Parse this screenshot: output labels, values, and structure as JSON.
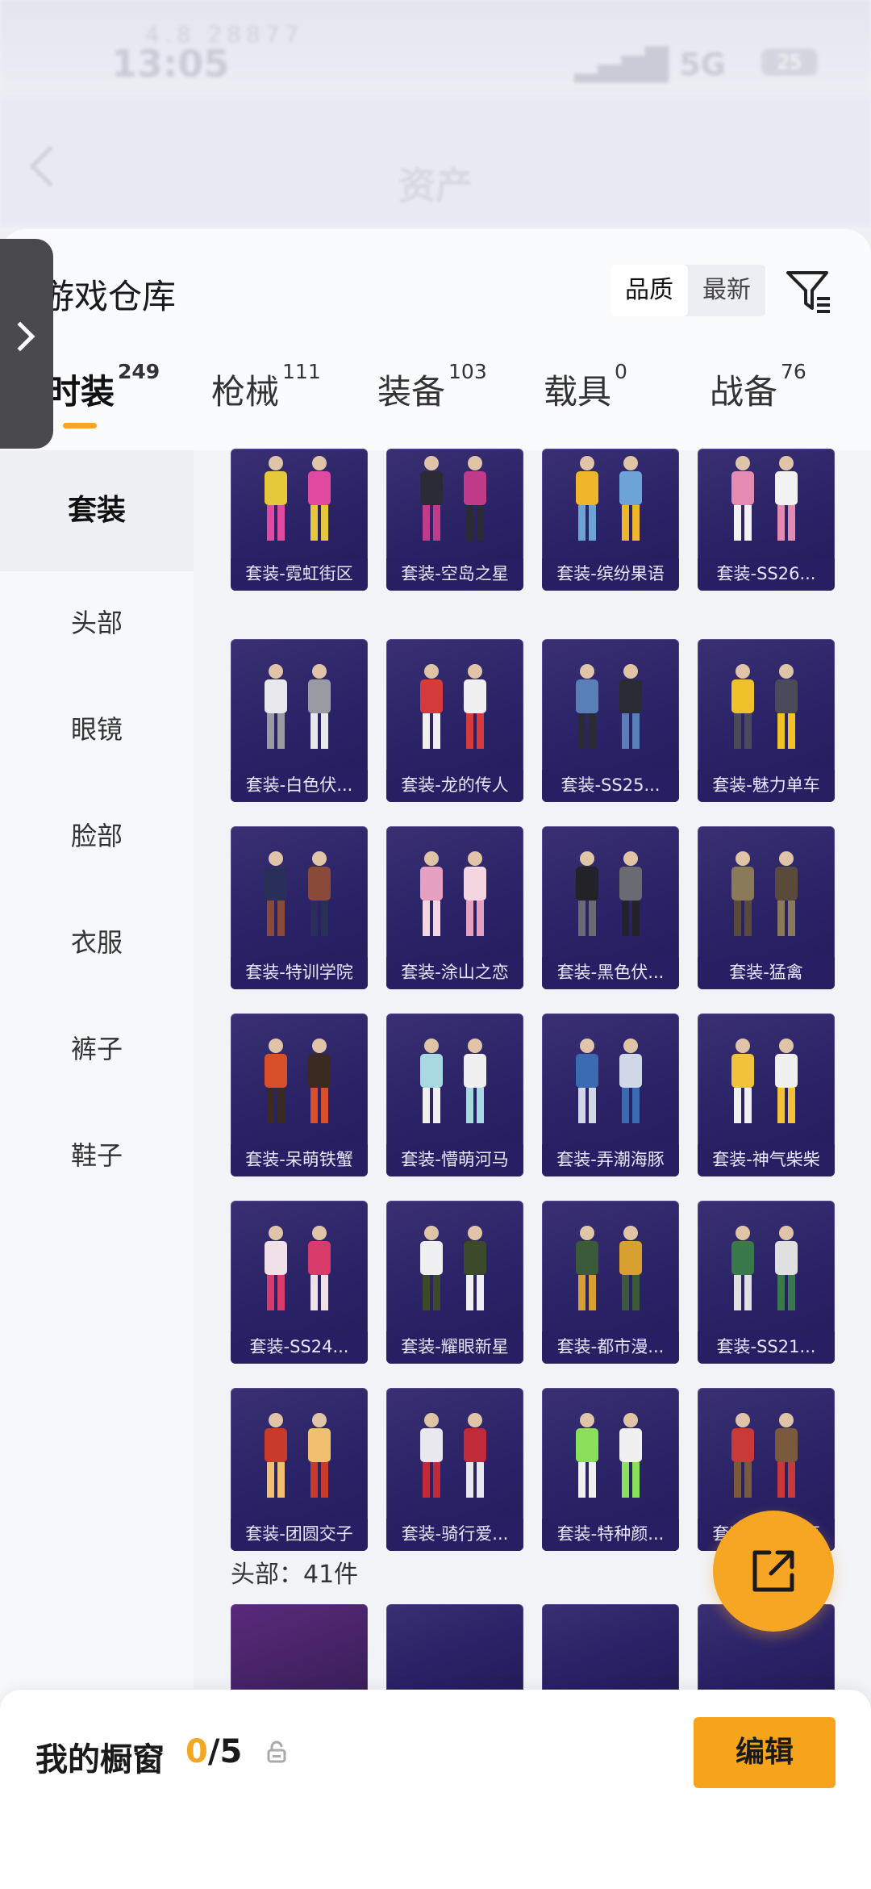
{
  "status": {
    "time": "13:05",
    "faint_left": "4.8   28877",
    "network": "5G",
    "battery": "25"
  },
  "header": {
    "title": "资产"
  },
  "panel": {
    "title": "游戏仓库",
    "sort": [
      "品质",
      "最新"
    ]
  },
  "tabs": [
    {
      "label": "时装",
      "count": "249"
    },
    {
      "label": "枪械",
      "count": "111"
    },
    {
      "label": "装备",
      "count": "103"
    },
    {
      "label": "载具",
      "count": "0"
    },
    {
      "label": "战备",
      "count": "76"
    }
  ],
  "categories": [
    "套装",
    "头部",
    "眼镜",
    "脸部",
    "衣服",
    "裤子",
    "鞋子"
  ],
  "items": [
    {
      "label": "套装-霓虹街区",
      "color": "#e6c93a",
      "accent": "#e04aa0"
    },
    {
      "label": "套装-空岛之星",
      "color": "#2b2b35",
      "accent": "#c03c8a"
    },
    {
      "label": "套装-缤纷果语",
      "color": "#f0b62a",
      "accent": "#6ea3d8"
    },
    {
      "label": "套装-SS26...",
      "color": "#e38bb0",
      "accent": "#f2f2f2"
    },
    {
      "label": "套装-白色伏...",
      "color": "#e8e8ec",
      "accent": "#9a9aa2"
    },
    {
      "label": "套装-龙的传人",
      "color": "#d63b3b",
      "accent": "#f0f0f0"
    },
    {
      "label": "套装-SS25...",
      "color": "#5a7fb8",
      "accent": "#2b2b35"
    },
    {
      "label": "套装-魅力单车",
      "color": "#f0c22a",
      "accent": "#4a4a5a"
    },
    {
      "label": "套装-特训学院",
      "color": "#2a2f5a",
      "accent": "#8a4a3a"
    },
    {
      "label": "套装-涂山之恋",
      "color": "#e6a0c0",
      "accent": "#f4d6e2"
    },
    {
      "label": "套装-黑色伏...",
      "color": "#222228",
      "accent": "#6a6a72"
    },
    {
      "label": "套装-猛禽",
      "color": "#8a7a5a",
      "accent": "#5a4a3a"
    },
    {
      "label": "套装-呆萌铁蟹",
      "color": "#d8502a",
      "accent": "#3a2a22"
    },
    {
      "label": "套装-懵萌河马",
      "color": "#a8d8e0",
      "accent": "#f0f0f0"
    },
    {
      "label": "套装-弄潮海豚",
      "color": "#3a6ab0",
      "accent": "#d0d8e8"
    },
    {
      "label": "套装-神气柴柴",
      "color": "#f2c23a",
      "accent": "#f0f0f0"
    },
    {
      "label": "套装-SS24...",
      "color": "#f0e0e8",
      "accent": "#d83a6a"
    },
    {
      "label": "套装-耀眼新星",
      "color": "#f0f0f2",
      "accent": "#3a4a2a"
    },
    {
      "label": "套装-都市漫...",
      "color": "#3a5a3a",
      "accent": "#d8a030"
    },
    {
      "label": "套装-SS21...",
      "color": "#3a7a4a",
      "accent": "#e0e0e0"
    },
    {
      "label": "套装-团圆交子",
      "color": "#c83a2a",
      "accent": "#f0c070"
    },
    {
      "label": "套装-骑行爱...",
      "color": "#e8e8ee",
      "accent": "#c02a3a"
    },
    {
      "label": "套装-特种颜...",
      "color": "#8ae05a",
      "accent": "#f0f0f0"
    },
    {
      "label": "套装-怒火燎原",
      "color": "#c83a3a",
      "accent": "#7a5a3a"
    }
  ],
  "head_section": {
    "label": "头部：41件"
  },
  "bottom": {
    "label": "我的橱窗",
    "count_current": "0",
    "count_total": "/5",
    "edit": "编辑"
  },
  "colors": {
    "accent": "#f6a623",
    "card_bg": "#2a2266"
  }
}
